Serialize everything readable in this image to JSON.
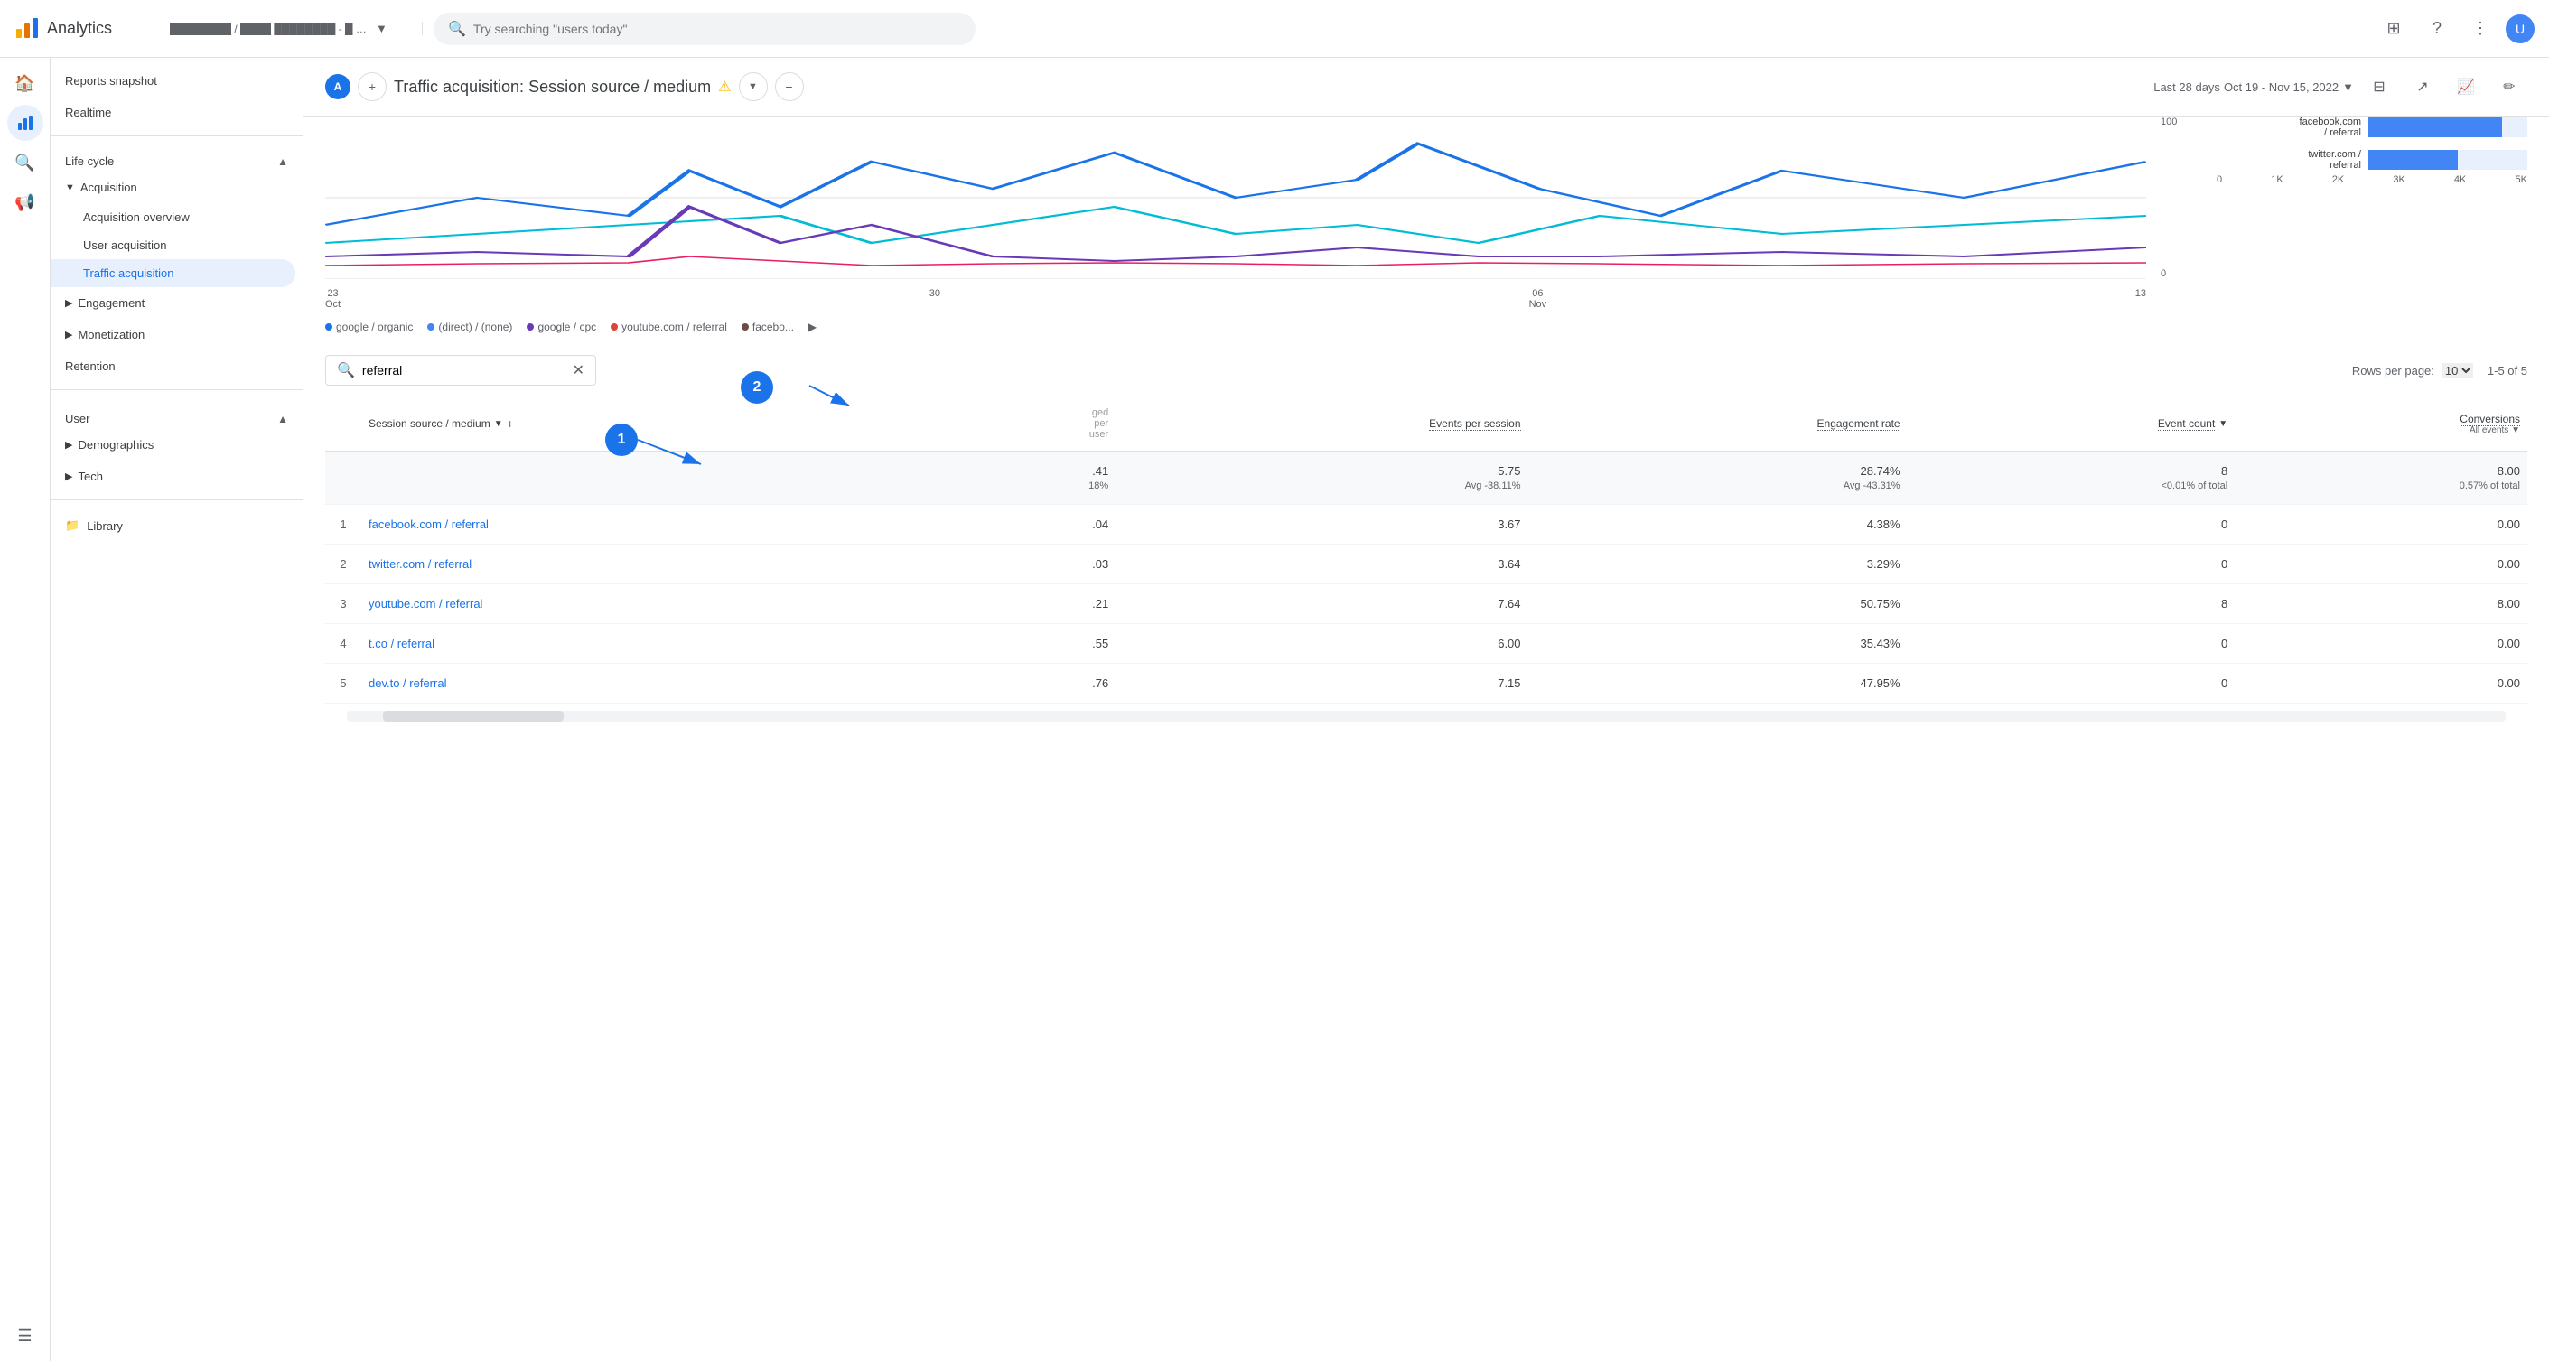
{
  "topbar": {
    "app_name": "Analytics",
    "account_text": "████████ / ████ ████████ - █ - ██",
    "search_placeholder": "Try searching \"users today\"",
    "avatar_initials": "U"
  },
  "sidebar": {
    "reports_snapshot": "Reports snapshot",
    "realtime": "Realtime",
    "lifecycle_section": "Life cycle",
    "acquisition": "Acquisition",
    "acquisition_overview": "Acquisition overview",
    "user_acquisition": "User acquisition",
    "traffic_acquisition": "Traffic acquisition",
    "engagement": "Engagement",
    "monetization": "Monetization",
    "retention": "Retention",
    "user_section": "User",
    "demographics": "Demographics",
    "tech": "Tech",
    "library": "Library"
  },
  "page": {
    "title": "Traffic acquisition: Session source / medium",
    "date_label": "Last 28 days",
    "date_range": "Oct 19 - Nov 15, 2022"
  },
  "chart": {
    "x_labels": [
      "23",
      "Oct",
      "30",
      "06",
      "Nov",
      "13"
    ],
    "y_label_right": "100",
    "y_label_zero": "0",
    "legend": [
      {
        "color": "#1a73e8",
        "label": "google / organic"
      },
      {
        "color": "#4285f4",
        "label": "(direct) / (none)"
      },
      {
        "color": "#673ab7",
        "label": "google / cpc"
      },
      {
        "color": "#db4437",
        "label": "youtube.com / referral"
      },
      {
        "color": "#6d4c41",
        "label": "facebo..."
      }
    ],
    "bar_items": [
      {
        "label": "facebook.com\n/ referral",
        "value": 4200,
        "max": 5000
      },
      {
        "label": "twitter.com /\nreferral",
        "value": 2800,
        "max": 5000
      }
    ],
    "bar_axis": [
      "0",
      "1K",
      "2K",
      "3K",
      "4K",
      "5K"
    ]
  },
  "table": {
    "search_value": "referral",
    "rows_per_page_label": "Rows per page:",
    "rows_per_page_value": "10",
    "pagination": "1-5 of 5",
    "columns": {
      "session_source_medium": "Session source / medium",
      "events_per_session": "Events per session",
      "engagement_rate": "Engagement rate",
      "event_count": "Event count",
      "conversions": "Conversions",
      "conversions_sub": "All events"
    },
    "total_row": {
      "col3": ".41",
      "col3_sub": "18%",
      "col4": "5.75",
      "col4_sub": "Avg -38.11%",
      "col5": "28.74%",
      "col5_sub": "Avg -43.31%",
      "col6": "8",
      "col6_sub": "<0.01% of total",
      "col7": "8.00",
      "col7_sub": "0.57% of total"
    },
    "rows": [
      {
        "num": "1",
        "source": "facebook.com / referral",
        "col3": ".04",
        "col4": "3.67",
        "col5": "4.38%",
        "col6": "0",
        "col7": "0.00"
      },
      {
        "num": "2",
        "source": "twitter.com / referral",
        "col3": ".03",
        "col4": "3.64",
        "col5": "3.29%",
        "col6": "0",
        "col7": "0.00"
      },
      {
        "num": "3",
        "source": "youtube.com / referral",
        "col3": ".21",
        "col4": "7.64",
        "col5": "50.75%",
        "col6": "8",
        "col7": "8.00"
      },
      {
        "num": "4",
        "source": "t.co / referral",
        "col3": ".55",
        "col4": "6.00",
        "col5": "35.43%",
        "col6": "0",
        "col7": "0.00"
      },
      {
        "num": "5",
        "source": "dev.to / referral",
        "col3": ".76",
        "col4": "7.15",
        "col5": "47.95%",
        "col6": "0",
        "col7": "0.00"
      }
    ],
    "badge1_label": "1",
    "badge2_label": "2"
  }
}
